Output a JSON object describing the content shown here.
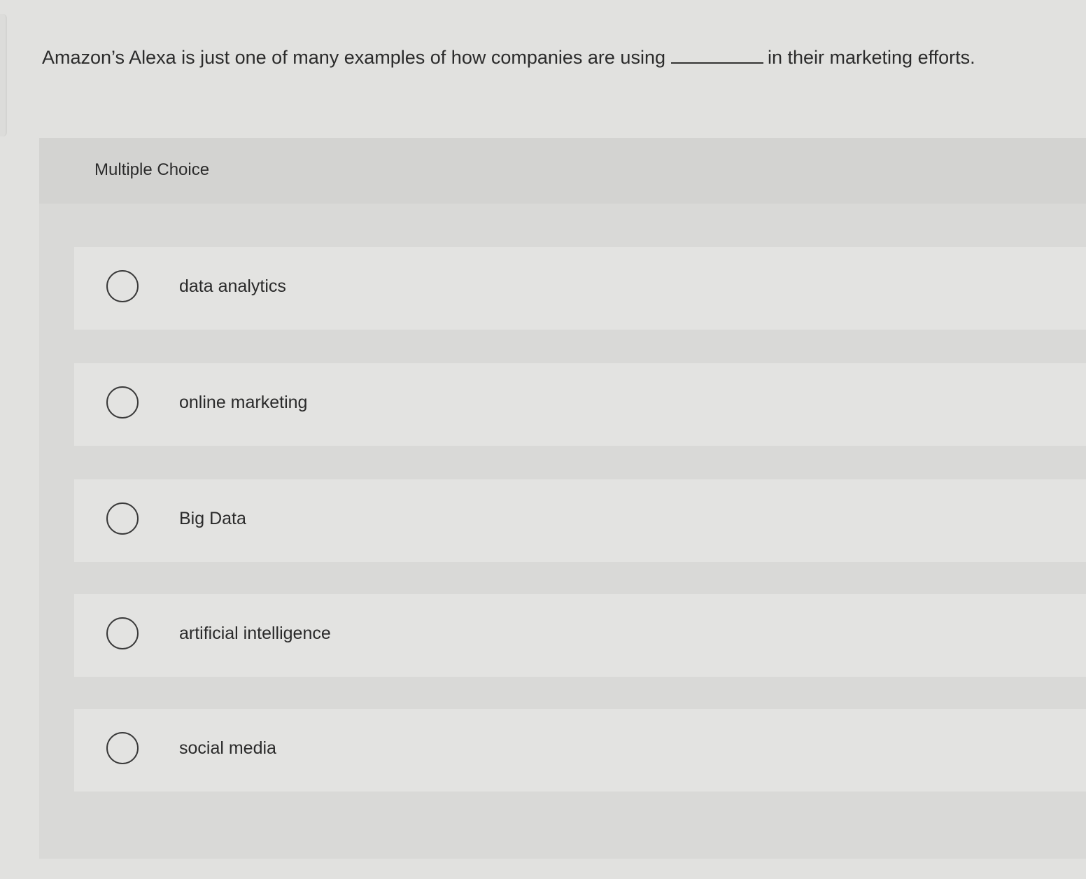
{
  "question": {
    "text_before": "Amazon’s Alexa is just one of many examples of how companies are using",
    "text_after": "in their marketing efforts."
  },
  "multiple_choice": {
    "label": "Multiple Choice",
    "options": [
      {
        "label": "data analytics"
      },
      {
        "label": "online marketing"
      },
      {
        "label": "Big Data"
      },
      {
        "label": "artificial intelligence"
      },
      {
        "label": "social media"
      }
    ]
  },
  "colors": {
    "background": "#e1e1df",
    "panel": "#d9d9d7",
    "option_background": "#e3e3e1",
    "text": "#2a2a2a"
  },
  "icons": {
    "radio": "radio-circle-icon"
  }
}
